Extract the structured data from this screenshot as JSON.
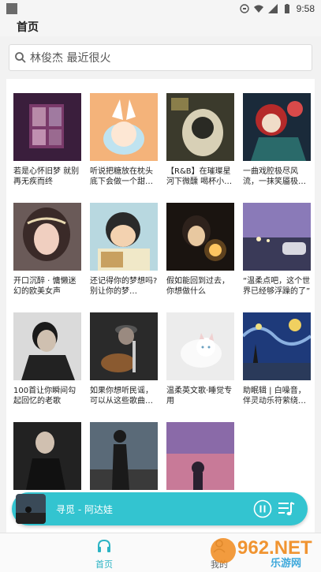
{
  "status_bar": {
    "time": "9:58"
  },
  "header": {
    "title": "首页"
  },
  "search": {
    "placeholder": "林俊杰 最近很火"
  },
  "playlists": [
    {
      "title": "若是心怀旧梦 就别再无疾而终"
    },
    {
      "title": "听说把糖放在枕头底下会做一个甜…"
    },
    {
      "title": "【R&B】在璀璨星河下微醺 喝杯小…"
    },
    {
      "title": "一曲戏腔极尽风流，一抹笑靥极…"
    },
    {
      "title": "开口沉醉 · 慵懒迷幻的欧美女声"
    },
    {
      "title": "还记得你的梦想吗? 别让你的梦…"
    },
    {
      "title": "假如能回到过去，你想做什么"
    },
    {
      "title": "“温柔点吧，这个世界已经够浮躁的了”"
    },
    {
      "title": "100首让你瞬间勾起回忆的老歌"
    },
    {
      "title": "如果你想听民谣，可以从这些歌曲…"
    },
    {
      "title": "温柔英文歌·睡觉专用"
    },
    {
      "title": "助眠辑 | 白噪音，伴灵动乐符萦绕…"
    },
    {
      "title": ""
    },
    {
      "title": ""
    },
    {
      "title": ""
    }
  ],
  "player": {
    "track": "寻觅 - 阿达娃"
  },
  "tabs": [
    {
      "label": "首页",
      "active": true
    },
    {
      "label": "我的",
      "active": false
    }
  ],
  "watermark": {
    "text": "962.NET",
    "subtext": "乐游网"
  },
  "colors": {
    "accent": "#33c4d0",
    "tab_active": "#2bb3c4"
  }
}
